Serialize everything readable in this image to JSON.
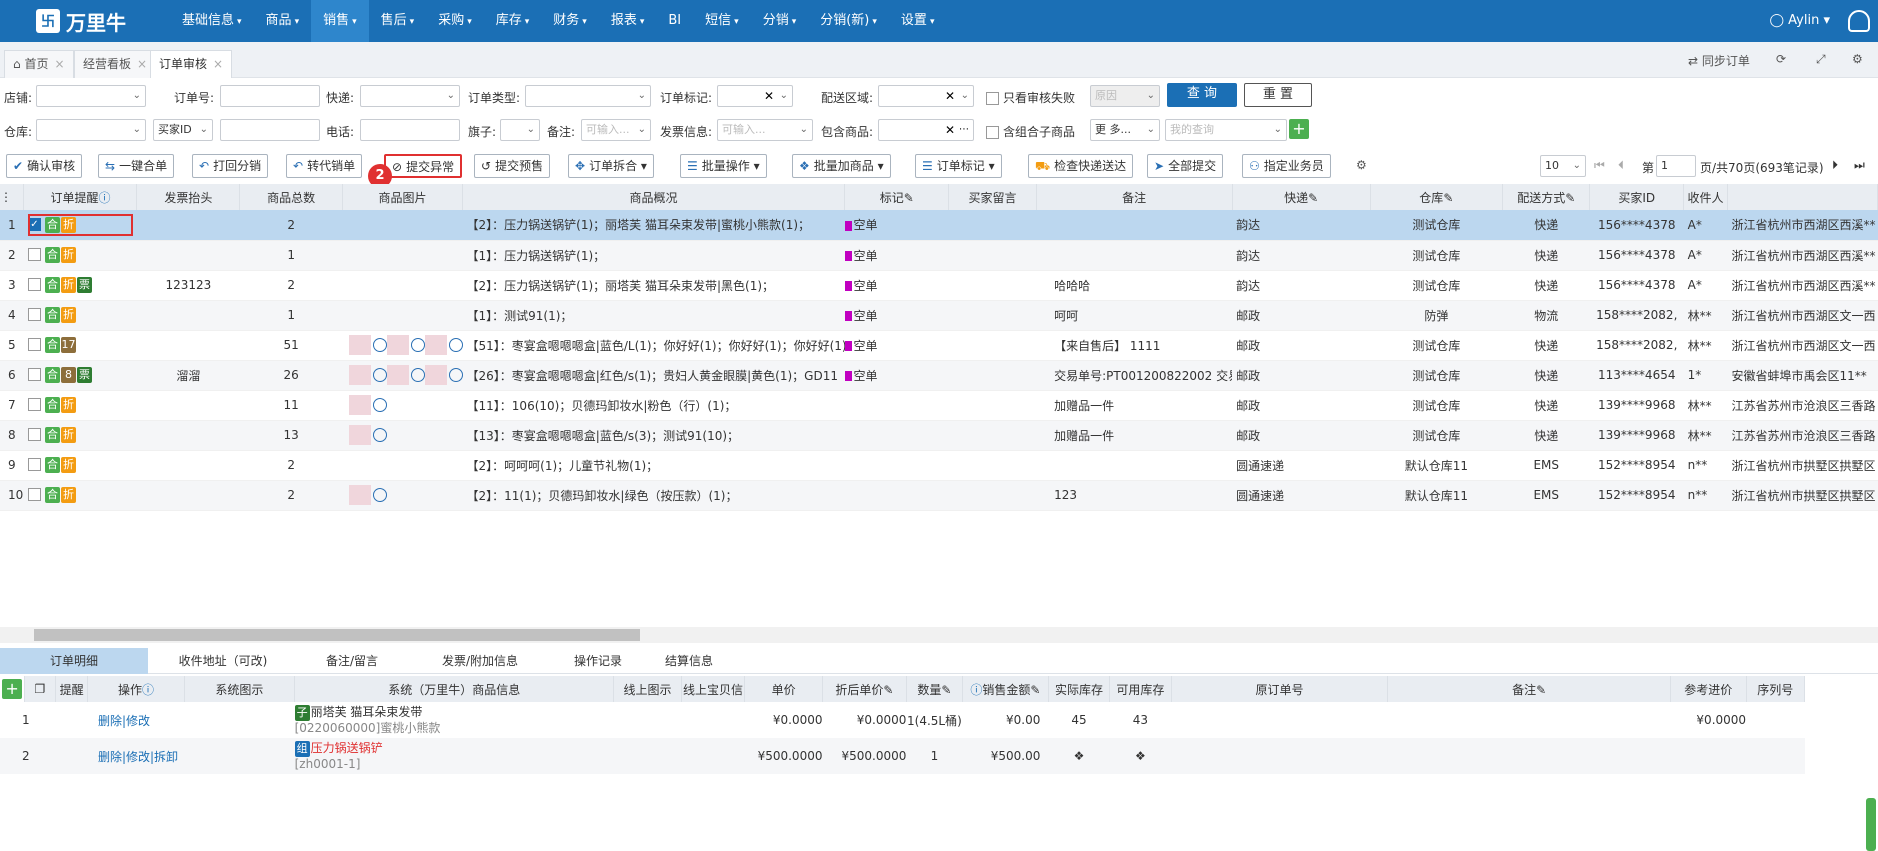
{
  "app": {
    "logo": "万里牛",
    "user": "Aylin"
  },
  "menu": [
    {
      "label": "基础信息"
    },
    {
      "label": "商品"
    },
    {
      "label": "销售",
      "active": true
    },
    {
      "label": "售后"
    },
    {
      "label": "采购"
    },
    {
      "label": "库存"
    },
    {
      "label": "财务"
    },
    {
      "label": "报表"
    },
    {
      "label": "BI"
    },
    {
      "label": "短信"
    },
    {
      "label": "分销"
    },
    {
      "label": "分销(新)"
    },
    {
      "label": "设置"
    }
  ],
  "tabs": [
    {
      "label": "首页"
    },
    {
      "label": "经营看板"
    },
    {
      "label": "订单审核",
      "active": true
    }
  ],
  "tabbar_right": {
    "sync": "同步订单"
  },
  "filters": {
    "shop": "店铺:",
    "order_no": "订单号:",
    "express": "快递:",
    "order_type": "订单类型:",
    "order_mark": "订单标记:",
    "delivery_area": "配送区域:",
    "only_fail": "只看审核失败",
    "reason_placeholder": "原因",
    "query": "查 询",
    "reset": "重 置",
    "warehouse": "仓库:",
    "buyer_id": "买家ID",
    "phone": "电话:",
    "flag": "旗子:",
    "remark": "备注:",
    "remark_placeholder": "可输入...",
    "invoice": "发票信息:",
    "invoice_placeholder": "可输入...",
    "contains_goods": "包含商品:",
    "contains_combo": "含组合子商品",
    "more": "更 多...",
    "my_query": "我的查询"
  },
  "toolbar": [
    "确认审核",
    "一键合单",
    "打回分销",
    "转代销单",
    "提交异常",
    "提交预售",
    "订单拆合",
    "批量操作",
    "批量加商品",
    "订单标记",
    "检查快递送达",
    "全部提交",
    "指定业务员"
  ],
  "pager": {
    "size": "10",
    "prefix": "第",
    "page": "1",
    "suffix": "页/共70页(693笔记录)"
  },
  "annotations": {
    "one": "1",
    "two": "2"
  },
  "grid_headers": [
    "订单提醒",
    "发票抬头",
    "商品总数",
    "商品图片",
    "商品概况",
    "标记",
    "买家留言",
    "备注",
    "快递",
    "仓库",
    "配送方式",
    "买家ID",
    "收件人"
  ],
  "rows": [
    {
      "n": "1",
      "tags": [
        "合",
        "折"
      ],
      "invoice": "",
      "qty": "2",
      "imgs": 0,
      "summary": "【2】：压力锅送锅铲(1)；丽塔芙 猫耳朵束发带|蜜桃小熊款(1)；",
      "mark": "空单",
      "msg": "",
      "remark": "",
      "express": "韵达",
      "wh": "测试仓库",
      "ship": "快递",
      "buyer": "156****4378",
      "recv": "A*",
      "addr": "浙江省杭州市西湖区西溪**"
    },
    {
      "n": "2",
      "tags": [
        "合",
        "折"
      ],
      "invoice": "",
      "qty": "1",
      "imgs": 0,
      "summary": "【1】：压力锅送锅铲(1)；",
      "mark": "空单",
      "msg": "",
      "remark": "",
      "express": "韵达",
      "wh": "测试仓库",
      "ship": "快递",
      "buyer": "156****4378",
      "recv": "A*",
      "addr": "浙江省杭州市西湖区西溪**"
    },
    {
      "n": "3",
      "tags": [
        "合",
        "折",
        "票"
      ],
      "invoice": "123123",
      "qty": "2",
      "imgs": 0,
      "summary": "【2】：压力锅送锅铲(1)；丽塔芙 猫耳朵束发带|黑色(1)；",
      "mark": "空单",
      "msg": "",
      "remark": "哈哈哈",
      "express": "韵达",
      "wh": "测试仓库",
      "ship": "快递",
      "buyer": "156****4378",
      "recv": "A*",
      "addr": "浙江省杭州市西湖区西溪**"
    },
    {
      "n": "4",
      "tags": [
        "合",
        "折"
      ],
      "invoice": "",
      "qty": "1",
      "imgs": 0,
      "summary": "【1】：测试91(1)；",
      "mark": "空单",
      "msg": "",
      "remark": "呵呵",
      "express": "邮政",
      "wh": "防弹",
      "ship": "物流",
      "buyer": "158****2082,",
      "recv": "林**",
      "addr": "浙江省杭州市西湖区文一西"
    },
    {
      "n": "5",
      "tags": [
        "合",
        "17"
      ],
      "invoice": "",
      "qty": "51",
      "imgs": 3,
      "summary": "【51】：枣宴盒嗯嗯嗯盒|蓝色/L(1)；你好好(1)；你好好(1)；你好好(1)",
      "mark": "空单",
      "msg": "",
      "remark": "【来自售后】 1111",
      "express": "邮政",
      "wh": "测试仓库",
      "ship": "快递",
      "buyer": "158****2082,",
      "recv": "林**",
      "addr": "浙江省杭州市西湖区文一西"
    },
    {
      "n": "6",
      "tags": [
        "合",
        "8",
        "票"
      ],
      "invoice": "溜溜",
      "qty": "26",
      "imgs": 3,
      "summary": "【26】：枣宴盒嗯嗯嗯盒|红色/s(1)；贵妇人黄金眼膜|黄色(1)；GD11",
      "mark": "空单",
      "msg": "",
      "remark": "交易单号:PT001200822002 交易单号",
      "express": "邮政",
      "wh": "测试仓库",
      "ship": "快递",
      "buyer": "113****4654",
      "recv": "1*",
      "addr": "安徽省蚌埠市禹会区11**"
    },
    {
      "n": "7",
      "tags": [
        "合",
        "折"
      ],
      "invoice": "",
      "qty": "11",
      "imgs": 1,
      "summary": "【11】：106(10)；贝德玛卸妆水|粉色（行）(1)；",
      "mark": "",
      "msg": "",
      "remark": "加赠品一件",
      "express": "邮政",
      "wh": "测试仓库",
      "ship": "快递",
      "buyer": "139****9968",
      "recv": "林**",
      "addr": "江苏省苏州市沧浪区三香路"
    },
    {
      "n": "8",
      "tags": [
        "合",
        "折"
      ],
      "invoice": "",
      "qty": "13",
      "imgs": 1,
      "summary": "【13】：枣宴盒嗯嗯嗯盒|蓝色/s(3)；测试91(10)；",
      "mark": "",
      "msg": "",
      "remark": "加赠品一件",
      "express": "邮政",
      "wh": "测试仓库",
      "ship": "快递",
      "buyer": "139****9968",
      "recv": "林**",
      "addr": "江苏省苏州市沧浪区三香路"
    },
    {
      "n": "9",
      "tags": [
        "合",
        "折"
      ],
      "invoice": "",
      "qty": "2",
      "imgs": 0,
      "summary": "【2】：呵呵呵(1)；儿童节礼物(1)；",
      "mark": "",
      "msg": "",
      "remark": "",
      "express": "圆通速递",
      "wh": "默认仓库11",
      "ship": "EMS",
      "buyer": "152****8954",
      "recv": "n**",
      "addr": "浙江省杭州市拱墅区拱墅区"
    },
    {
      "n": "10",
      "tags": [
        "合",
        "折"
      ],
      "invoice": "",
      "qty": "2",
      "imgs": 1,
      "summary": "【2】：11(1)；贝德玛卸妆水|绿色（按压款）(1)；",
      "mark": "",
      "msg": "",
      "remark": "123",
      "express": "圆通速递",
      "wh": "默认仓库11",
      "ship": "EMS",
      "buyer": "152****8954",
      "recv": "n**",
      "addr": "浙江省杭州市拱墅区拱墅区"
    }
  ],
  "bottom_tabs": [
    "订单明细",
    "收件地址（可改)",
    "备注/留言",
    "发票/附加信息",
    "操作记录",
    "结算信息"
  ],
  "detail_headers": [
    "提醒",
    "操作",
    "系统图示",
    "系统（万里牛）商品信息",
    "线上图示",
    "线上宝贝信",
    "单价",
    "折后单价",
    "数量",
    "销售金额",
    "实际库存",
    "可用库存",
    "原订单号",
    "备注",
    "参考进价",
    "序列号"
  ],
  "detail_rows": [
    {
      "n": "1",
      "ops": "删除|修改",
      "tag": "子",
      "name": "丽塔芙 猫耳朵束发带",
      "code": "[0220060000]蜜桃小熊款",
      "price": "¥0.0000",
      "dprice": "¥0.0000",
      "qty": "1(4.5L桶)",
      "amount": "¥0.00",
      "stock": "45",
      "avail": "43",
      "ref": "¥0.0000"
    },
    {
      "n": "2",
      "ops": "删除|修改|拆卸",
      "tag": "组",
      "name": "压力锅送锅铲",
      "code": "[zh0001-1]",
      "price": "¥500.0000",
      "dprice": "¥500.0000",
      "qty": "1",
      "amount": "¥500.00",
      "stock": "",
      "avail": "",
      "ref": ""
    }
  ]
}
